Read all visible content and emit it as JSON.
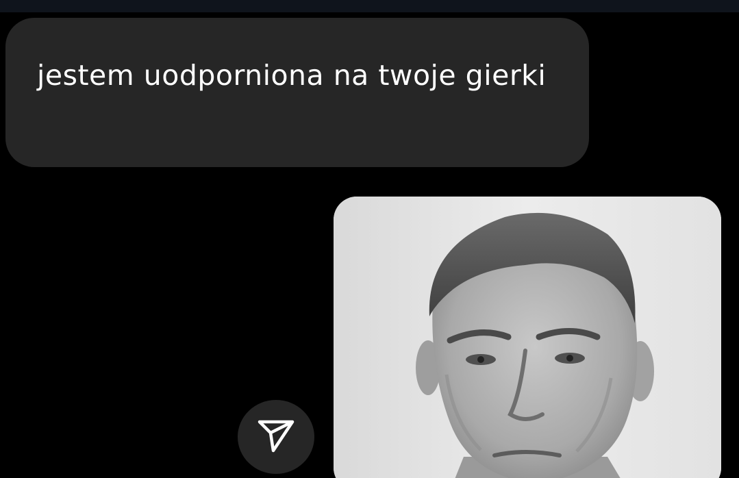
{
  "chat": {
    "received_message": {
      "text": "jestem uodporniona na twoje gierki",
      "bubble_color": "#262626",
      "text_color": "#ffffff"
    },
    "share_button": {
      "icon": "paper-plane-icon",
      "color": "#262626"
    },
    "sent_image": {
      "subject": "black-and-white portrait photo of a man",
      "background_color": "#e6e6e6"
    }
  },
  "theme": {
    "background": "#000000",
    "top_bar": "#0f141c"
  }
}
